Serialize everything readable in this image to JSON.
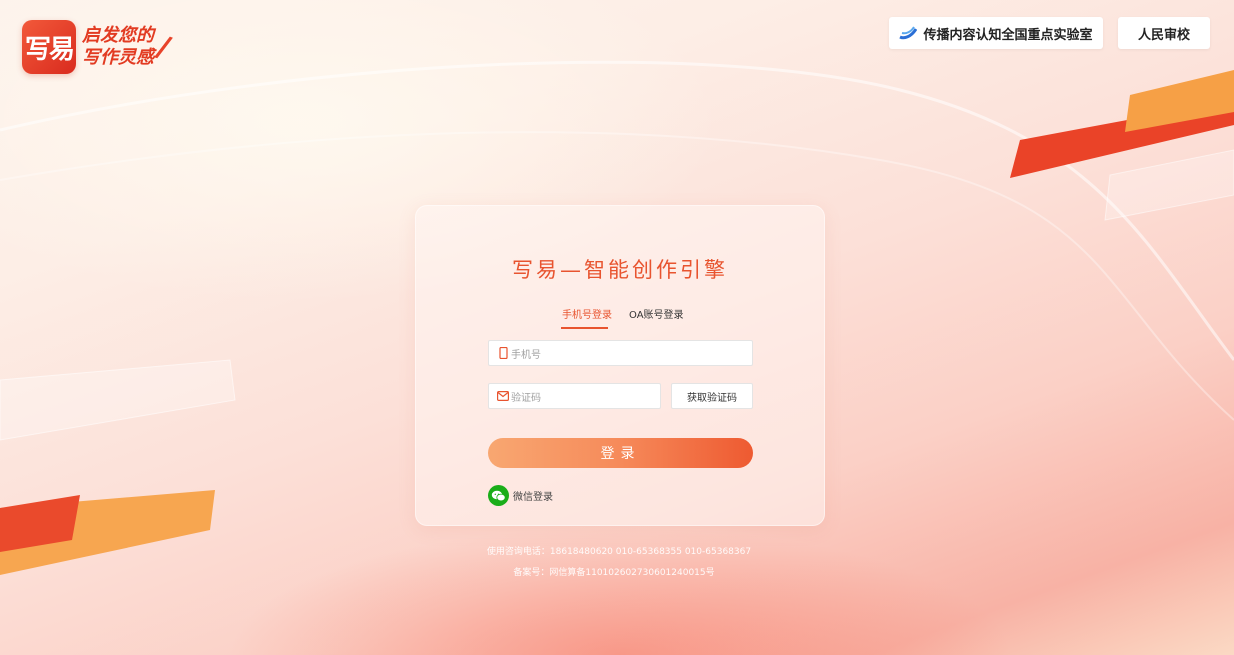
{
  "header": {
    "logo_mark": "写易",
    "logo_line1": "启发您的",
    "logo_line2": "写作灵感",
    "lab_button": "传播内容认知全国重点实验室",
    "rmsx_button": "人民审校"
  },
  "login": {
    "title": "写易—智能创作引擎",
    "tabs": [
      {
        "label": "手机号登录",
        "active": true
      },
      {
        "label": "OA账号登录",
        "active": false
      }
    ],
    "phone_placeholder": "手机号",
    "code_placeholder": "验证码",
    "get_code_label": "获取验证码",
    "submit_label": "登录",
    "wechat_label": "微信登录"
  },
  "footer": {
    "contact": "使用咨询电话：18618480620   010-65368355   010-65368367",
    "record": "备案号：网信算备110102602730601240015号"
  },
  "colors": {
    "accent": "#e8542f",
    "wechat": "#1aad19"
  }
}
